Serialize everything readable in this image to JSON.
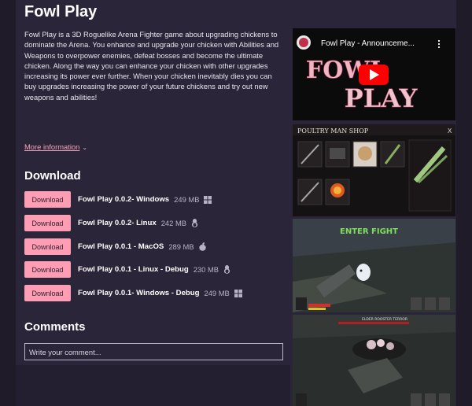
{
  "game": {
    "title": "Fowl Play",
    "description": "Fowl Play is a 3D Roguelike Arena Fighter game about upgrading chickens to dominate the Arena. You enhance and upgrade your chicken with Abilities and Weapons to overpower enemies, defeat bosses and become the ultimate chicken. Along the way you can enhance your chicken with other upgrades increasing its power ever further. When your chicken inevitably dies you can buy upgrades increasing the power of your future chickens and try out new weapons and abilities!",
    "more_info": "More information"
  },
  "download": {
    "heading": "Download",
    "button_label": "Download",
    "files": [
      {
        "name": "Fowl Play 0.0.2- Windows",
        "size": "249 MB",
        "os": "windows-icon"
      },
      {
        "name": "Fowl Play 0.0.2- Linux",
        "size": "242 MB",
        "os": "linux-icon"
      },
      {
        "name": "Fowl Play 0.0.1 - MacOS",
        "size": "289 MB",
        "os": "apple-icon"
      },
      {
        "name": "Fowl Play 0.0.1 - Linux - Debug",
        "size": "230 MB",
        "os": "linux-icon"
      },
      {
        "name": "Fowl Play 0.0.1- Windows - Debug",
        "size": "249 MB",
        "os": "windows-icon"
      }
    ]
  },
  "comments": {
    "heading": "Comments",
    "placeholder": "Write your comment..."
  },
  "video": {
    "title": "Fowl Play - Announceme...",
    "logo_line1": "FOWL",
    "logo_line2": "PLAY"
  },
  "screenshots": {
    "shop_title": "POULTRY MAN SHOP",
    "shop_close": "X",
    "enter_fight": "ENTER FIGHT",
    "boss_label": "ELDER ROOSTER TERROR"
  },
  "colors": {
    "page_bg": "#2a2538",
    "outer_bg": "#1f1b29",
    "button_bg": "#ff9db4",
    "link": "#f2a5bb"
  }
}
